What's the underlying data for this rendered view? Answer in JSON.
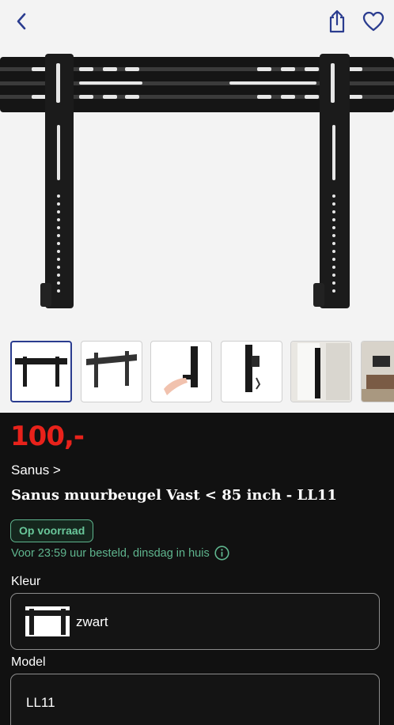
{
  "header": {
    "back_icon": "chevron-left-icon",
    "share_icon": "share-icon",
    "favorite_icon": "heart-icon",
    "icon_color": "#2a3c8f"
  },
  "gallery": {
    "hero_alt": "Sanus muurbeugel Vast < 85 inch - LL11",
    "thumbnail_count": 6,
    "active_index": 0
  },
  "product": {
    "price": "100,-",
    "brand": "Sanus >",
    "title": "Sanus muurbeugel Vast < 85 inch - LL11",
    "stock_badge": "Op voorraad",
    "delivery": "Voor 23:59 uur besteld, dinsdag in huis",
    "info_icon": "info-icon"
  },
  "options": {
    "color_label": "Kleur",
    "color_value": "zwart",
    "model_label": "Model",
    "model_value": "LL11"
  },
  "colors": {
    "price": "#e8221b",
    "accent_green": "#5fb58e",
    "brand_blue": "#2a3c8f"
  }
}
